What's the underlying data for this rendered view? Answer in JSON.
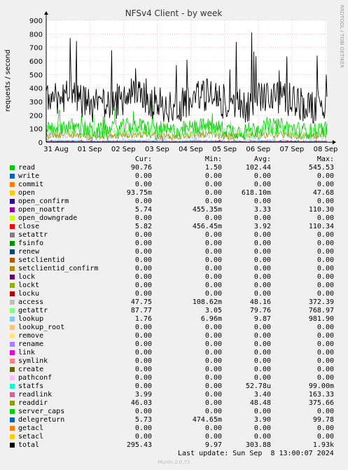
{
  "chart_data": {
    "type": "line",
    "title": "NFSv4 Client - by week",
    "ylabel": "requests / second",
    "xlabel": "",
    "side_label": "RRDTOOL / TOBI OETIKER",
    "x_ticks": [
      "31 Aug",
      "01 Sep",
      "02 Sep",
      "03 Sep",
      "04 Sep",
      "05 Sep",
      "06 Sep",
      "07 Sep",
      "08 Sep"
    ],
    "y_ticks": [
      0,
      100,
      200,
      300,
      400,
      500,
      600,
      700,
      800,
      900
    ],
    "ylim": [
      0,
      900
    ],
    "grid": true,
    "legend_headers": [
      "Cur:",
      "Min:",
      "Avg:",
      "Max:"
    ],
    "series": [
      {
        "name": "read",
        "color": "#00cc00",
        "cur": "90.76",
        "min": "1.50",
        "avg": "102.44",
        "max": "545.53"
      },
      {
        "name": "write",
        "color": "#0066b3",
        "cur": "0.00",
        "min": "0.00",
        "avg": "0.00",
        "max": "0.00"
      },
      {
        "name": "commit",
        "color": "#ff8000",
        "cur": "0.00",
        "min": "0.00",
        "avg": "0.00",
        "max": "0.00"
      },
      {
        "name": "open",
        "color": "#ffcc00",
        "cur": "93.75m",
        "min": "0.00",
        "avg": "618.10m",
        "max": "47.68"
      },
      {
        "name": "open_confirm",
        "color": "#330099",
        "cur": "0.00",
        "min": "0.00",
        "avg": "0.00",
        "max": "0.00"
      },
      {
        "name": "open_noattr",
        "color": "#990099",
        "cur": "5.74",
        "min": "455.35m",
        "avg": "3.33",
        "max": "110.30"
      },
      {
        "name": "open_downgrade",
        "color": "#ccff00",
        "cur": "0.00",
        "min": "0.00",
        "avg": "0.00",
        "max": "0.00"
      },
      {
        "name": "close",
        "color": "#ff0000",
        "cur": "5.82",
        "min": "456.45m",
        "avg": "3.92",
        "max": "110.34"
      },
      {
        "name": "setattr",
        "color": "#808080",
        "cur": "0.00",
        "min": "0.00",
        "avg": "0.00",
        "max": "0.00"
      },
      {
        "name": "fsinfo",
        "color": "#008f00",
        "cur": "0.00",
        "min": "0.00",
        "avg": "0.00",
        "max": "0.00"
      },
      {
        "name": "renew",
        "color": "#00487d",
        "cur": "0.00",
        "min": "0.00",
        "avg": "0.00",
        "max": "0.00"
      },
      {
        "name": "setclientid",
        "color": "#b35a00",
        "cur": "0.00",
        "min": "0.00",
        "avg": "0.00",
        "max": "0.00"
      },
      {
        "name": "setclientid_confirm",
        "color": "#b38f00",
        "cur": "0.00",
        "min": "0.00",
        "avg": "0.00",
        "max": "0.00"
      },
      {
        "name": "lock",
        "color": "#6b006b",
        "cur": "0.00",
        "min": "0.00",
        "avg": "0.00",
        "max": "0.00"
      },
      {
        "name": "lockt",
        "color": "#8fb300",
        "cur": "0.00",
        "min": "0.00",
        "avg": "0.00",
        "max": "0.00"
      },
      {
        "name": "locku",
        "color": "#b30000",
        "cur": "0.00",
        "min": "0.00",
        "avg": "0.00",
        "max": "0.00"
      },
      {
        "name": "access",
        "color": "#bebebe",
        "cur": "47.75",
        "min": "108.62m",
        "avg": "48.16",
        "max": "372.39"
      },
      {
        "name": "getattr",
        "color": "#80ff80",
        "cur": "87.77",
        "min": "3.05",
        "avg": "79.76",
        "max": "768.97"
      },
      {
        "name": "lookup",
        "color": "#80c9ff",
        "cur": "1.76",
        "min": "6.96m",
        "avg": "9.87",
        "max": "981.90"
      },
      {
        "name": "lookup_root",
        "color": "#ffc080",
        "cur": "0.00",
        "min": "0.00",
        "avg": "0.00",
        "max": "0.00"
      },
      {
        "name": "remove",
        "color": "#ffe680",
        "cur": "0.00",
        "min": "0.00",
        "avg": "0.00",
        "max": "0.00"
      },
      {
        "name": "rename",
        "color": "#aa80ff",
        "cur": "0.00",
        "min": "0.00",
        "avg": "0.00",
        "max": "0.00"
      },
      {
        "name": "link",
        "color": "#ee00cc",
        "cur": "0.00",
        "min": "0.00",
        "avg": "0.00",
        "max": "0.00"
      },
      {
        "name": "symlink",
        "color": "#ff8080",
        "cur": "0.00",
        "min": "0.00",
        "avg": "0.00",
        "max": "0.00"
      },
      {
        "name": "create",
        "color": "#666600",
        "cur": "0.00",
        "min": "0.00",
        "avg": "0.00",
        "max": "0.00"
      },
      {
        "name": "pathconf",
        "color": "#ffbfff",
        "cur": "0.00",
        "min": "0.00",
        "avg": "0.00",
        "max": "0.00"
      },
      {
        "name": "statfs",
        "color": "#00ffcc",
        "cur": "0.00",
        "min": "0.00",
        "avg": "52.78u",
        "max": "99.00m"
      },
      {
        "name": "readlink",
        "color": "#cc6699",
        "cur": "3.99",
        "min": "0.00",
        "avg": "3.40",
        "max": "163.33"
      },
      {
        "name": "readdir",
        "color": "#999900",
        "cur": "46.03",
        "min": "0.00",
        "avg": "48.48",
        "max": "375.66"
      },
      {
        "name": "server_caps",
        "color": "#00cc00",
        "cur": "0.00",
        "min": "0.00",
        "avg": "0.00",
        "max": "0.00"
      },
      {
        "name": "delegreturn",
        "color": "#0066b3",
        "cur": "5.73",
        "min": "474.65m",
        "avg": "3.90",
        "max": "99.78"
      },
      {
        "name": "getacl",
        "color": "#ff8000",
        "cur": "0.00",
        "min": "0.00",
        "avg": "0.00",
        "max": "0.00"
      },
      {
        "name": "setacl",
        "color": "#ffcc00",
        "cur": "0.00",
        "min": "0.00",
        "avg": "0.00",
        "max": "0.00"
      },
      {
        "name": "total",
        "color": "#000000",
        "cur": "295.43",
        "min": "9.97",
        "avg": "303.88",
        "max": "1.93k"
      }
    ]
  },
  "footer": {
    "last_update": "Last update: Sun Sep  8 13:00:07 2024",
    "version": "Munin 2.0.73"
  }
}
